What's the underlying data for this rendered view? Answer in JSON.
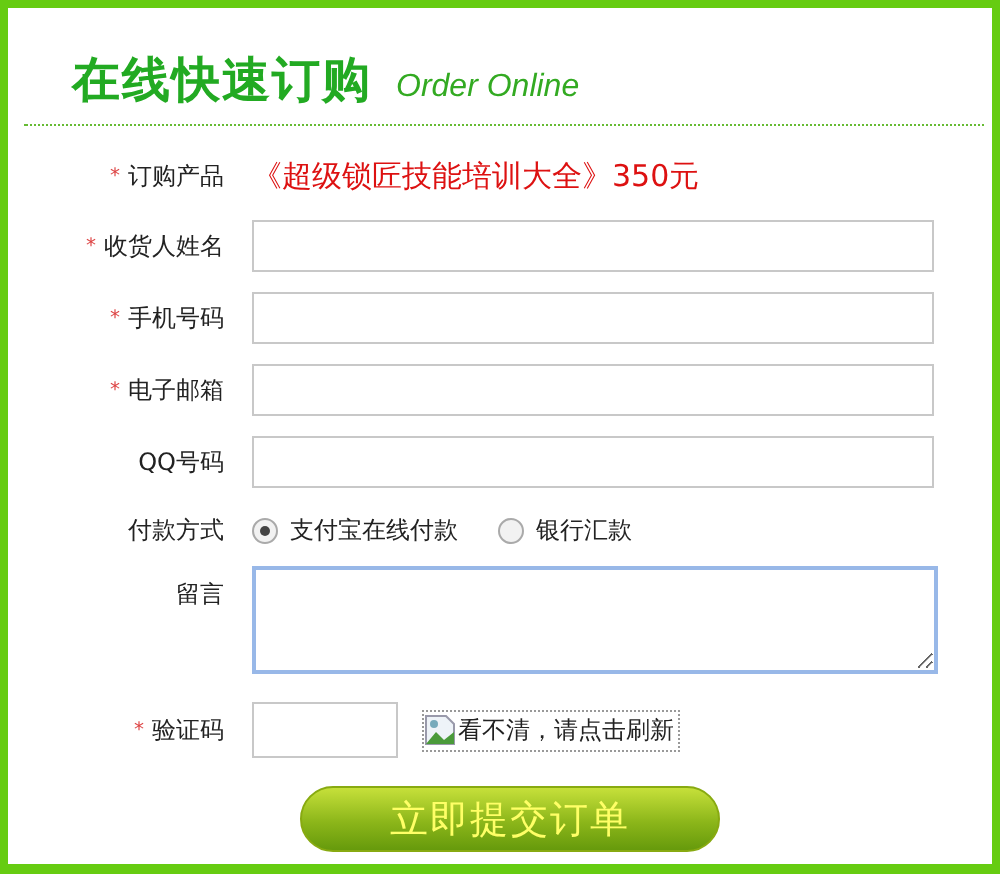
{
  "title": "在线快速订购",
  "subtitle": "Order Online",
  "fields": [
    {
      "kind": "text",
      "mark": "*",
      "label": "订购产品",
      "value": "《超级锁匠技能培训大全》350元"
    },
    {
      "kind": "input",
      "mark": "*",
      "label": "收货人姓名"
    },
    {
      "kind": "input",
      "mark": "*",
      "label": "手机号码"
    },
    {
      "kind": "input",
      "mark": "*",
      "label": "电子邮箱"
    },
    {
      "kind": "input",
      "label": "QQ号码"
    },
    {
      "kind": "radio",
      "label": "付款方式",
      "options": [
        {
          "label": "支付宝在线付款",
          "selected": true
        },
        {
          "label": "银行汇款",
          "selected": false
        }
      ]
    },
    {
      "kind": "textarea",
      "label": "留言",
      "focused": true
    },
    {
      "kind": "captcha",
      "mark": "*",
      "label": "验证码",
      "image_alt": "看不清，请点击刷新"
    }
  ],
  "submit": "立即提交订单"
}
